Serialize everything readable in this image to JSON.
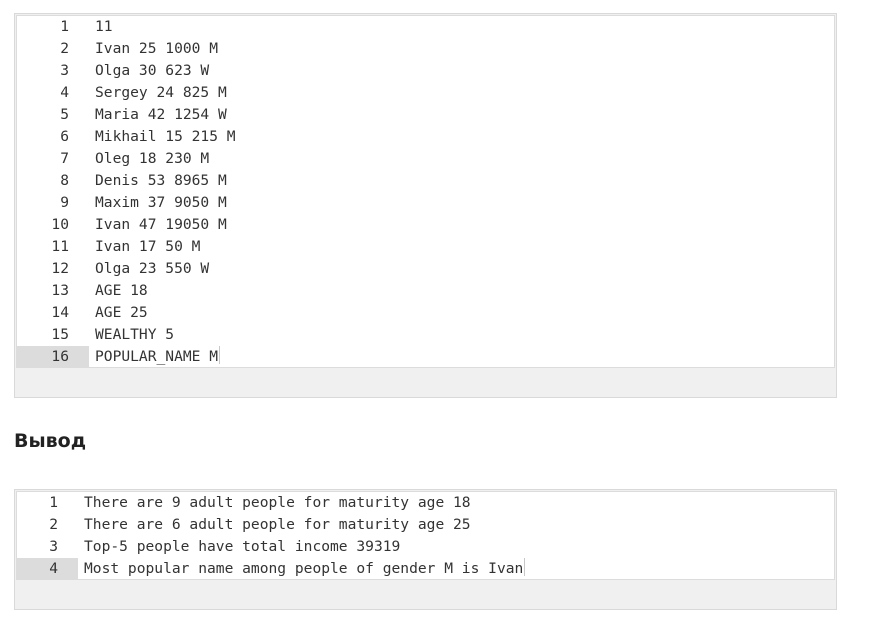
{
  "input_editor": {
    "lines": [
      {
        "num": "1",
        "text": "11"
      },
      {
        "num": "2",
        "text": "Ivan 25 1000 M"
      },
      {
        "num": "3",
        "text": "Olga 30 623 W"
      },
      {
        "num": "4",
        "text": "Sergey 24 825 M"
      },
      {
        "num": "5",
        "text": "Maria 42 1254 W"
      },
      {
        "num": "6",
        "text": "Mikhail 15 215 M"
      },
      {
        "num": "7",
        "text": "Oleg 18 230 M"
      },
      {
        "num": "8",
        "text": "Denis 53 8965 M"
      },
      {
        "num": "9",
        "text": "Maxim 37 9050 M"
      },
      {
        "num": "10",
        "text": "Ivan 47 19050 M"
      },
      {
        "num": "11",
        "text": "Ivan 17 50 M"
      },
      {
        "num": "12",
        "text": "Olga 23 550 W"
      },
      {
        "num": "13",
        "text": "AGE 18"
      },
      {
        "num": "14",
        "text": "AGE 25"
      },
      {
        "num": "15",
        "text": "WEALTHY 5"
      },
      {
        "num": "16",
        "text": "POPULAR_NAME M"
      }
    ]
  },
  "output_section": {
    "heading": "Вывод"
  },
  "output_editor": {
    "lines": [
      {
        "num": "1",
        "text": "There are 9 adult people for maturity age 18"
      },
      {
        "num": "2",
        "text": "There are 6 adult people for maturity age 25"
      },
      {
        "num": "3",
        "text": "Top-5 people have total income 39319"
      },
      {
        "num": "4",
        "text": "Most popular name among people of gender M is Ivan"
      }
    ]
  }
}
